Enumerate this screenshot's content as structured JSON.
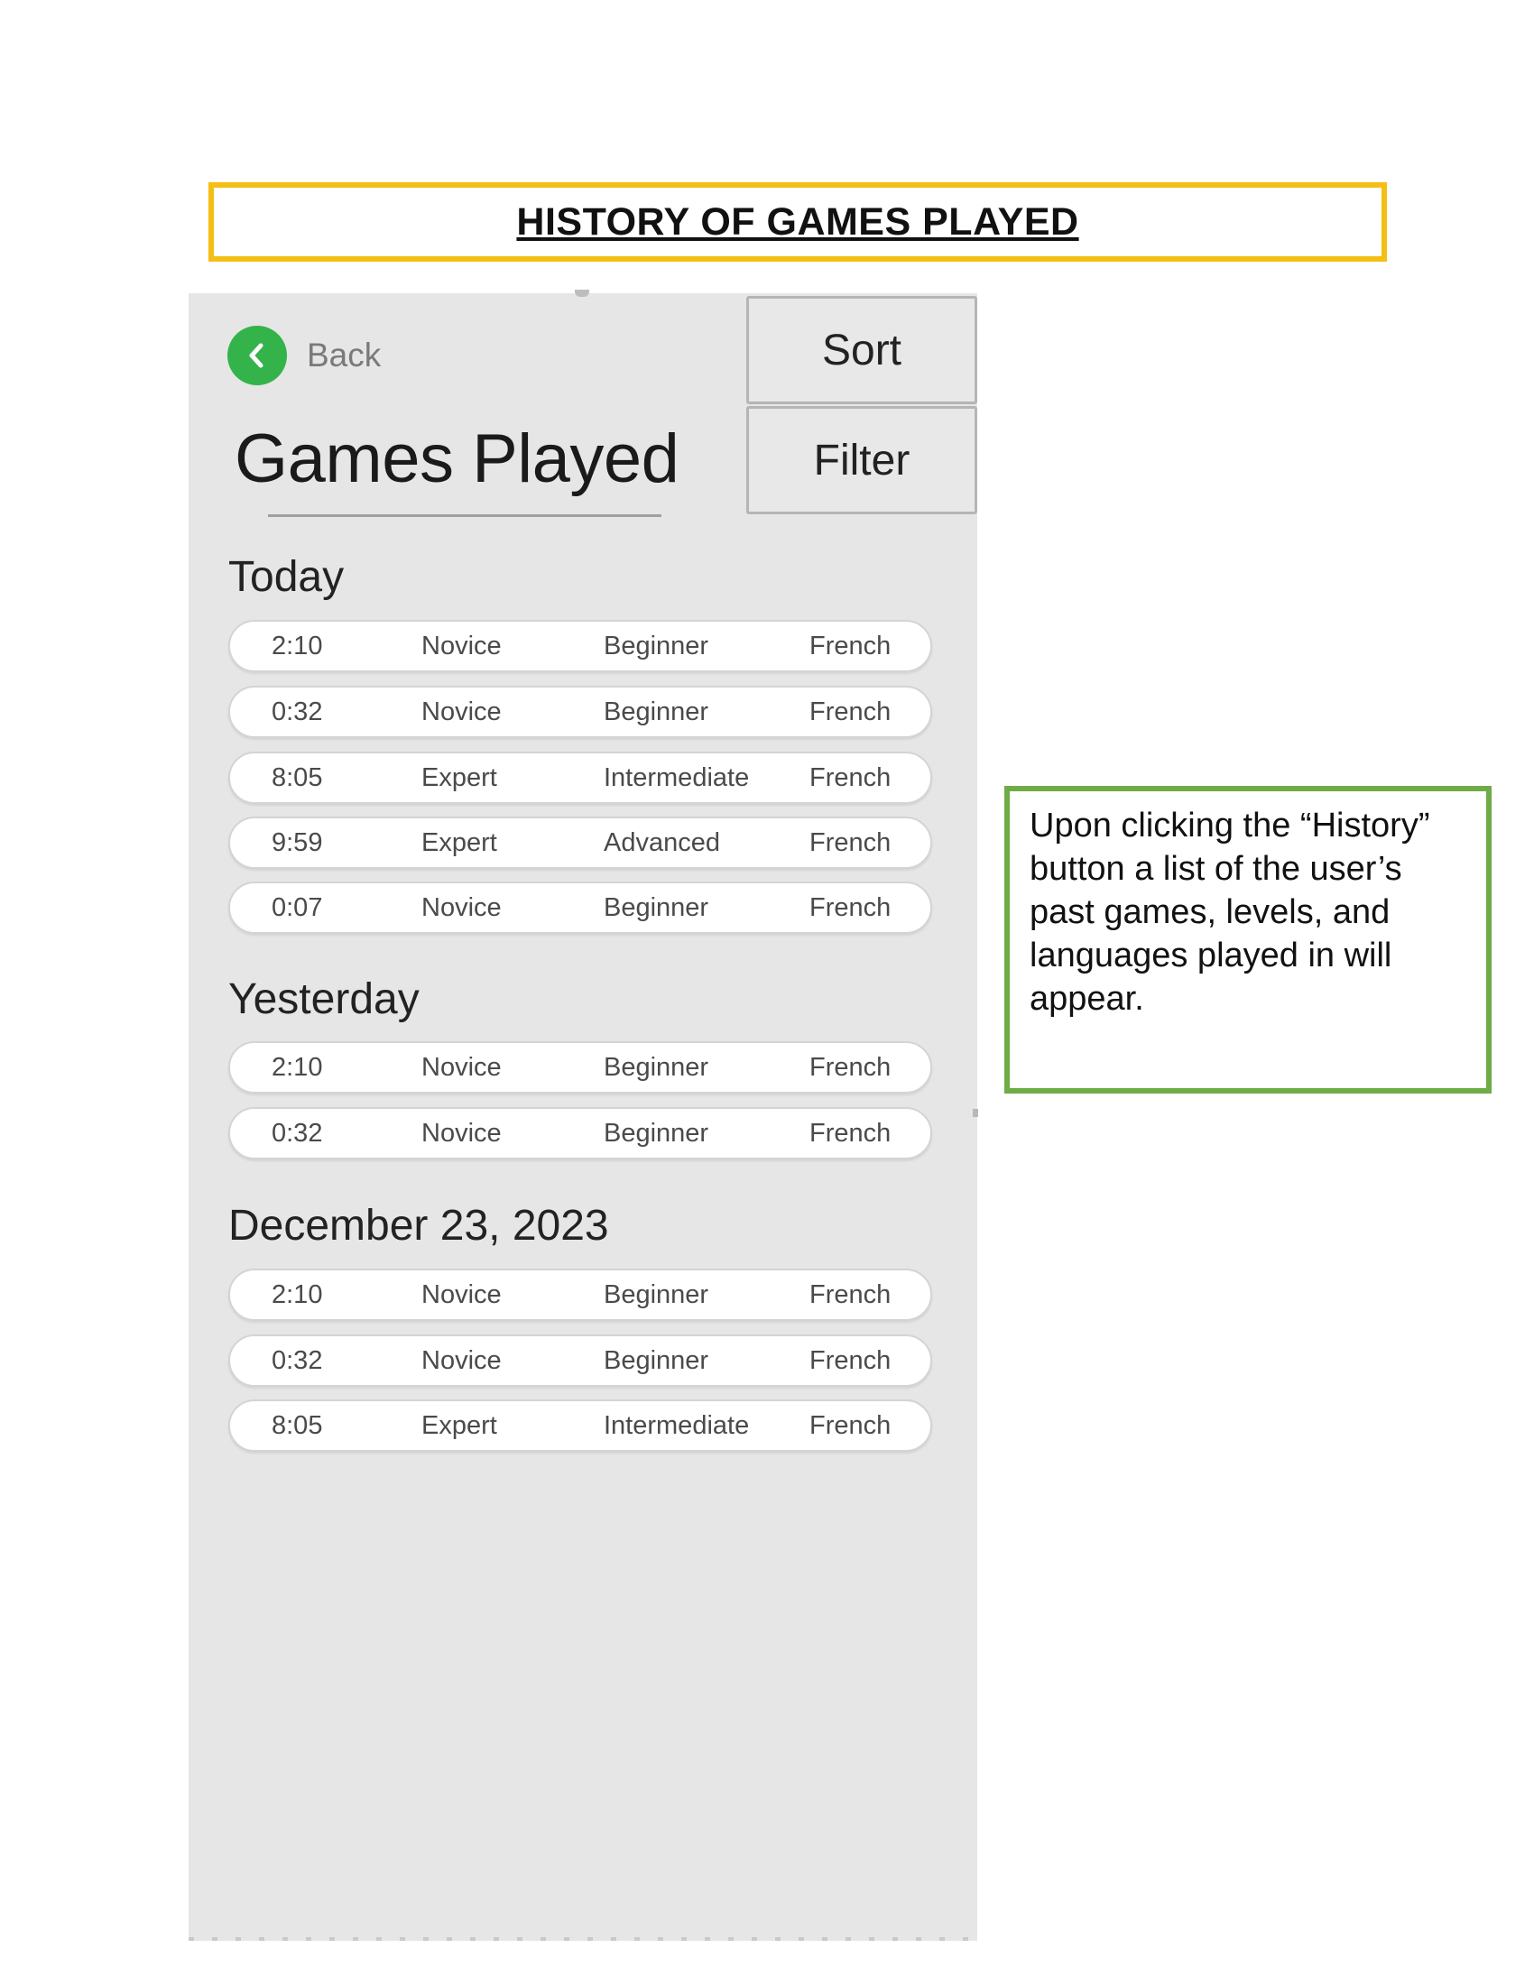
{
  "page_title": "HISTORY OF GAMES PLAYED",
  "header": {
    "back_label": "Back",
    "title": "Games Played",
    "sort_label": "Sort",
    "filter_label": "Filter"
  },
  "sections": [
    {
      "heading": "Today",
      "rows": [
        {
          "time": "2:10",
          "skill": "Novice",
          "level": "Beginner",
          "language": "French"
        },
        {
          "time": "0:32",
          "skill": "Novice",
          "level": "Beginner",
          "language": "French"
        },
        {
          "time": "8:05",
          "skill": "Expert",
          "level": "Intermediate",
          "language": "French"
        },
        {
          "time": "9:59",
          "skill": "Expert",
          "level": "Advanced",
          "language": "French"
        },
        {
          "time": "0:07",
          "skill": "Novice",
          "level": "Beginner",
          "language": "French"
        }
      ]
    },
    {
      "heading": "Yesterday",
      "rows": [
        {
          "time": "2:10",
          "skill": "Novice",
          "level": "Beginner",
          "language": "French"
        },
        {
          "time": "0:32",
          "skill": "Novice",
          "level": "Beginner",
          "language": "French"
        }
      ]
    },
    {
      "heading": "December 23, 2023",
      "rows": [
        {
          "time": "2:10",
          "skill": "Novice",
          "level": "Beginner",
          "language": "French"
        },
        {
          "time": "0:32",
          "skill": "Novice",
          "level": "Beginner",
          "language": "French"
        },
        {
          "time": "8:05",
          "skill": "Expert",
          "level": "Intermediate",
          "language": "French"
        }
      ]
    }
  ],
  "note": "Upon clicking the “History” button a list of the user’s past games, levels, and languages played in will appear.",
  "icons": {
    "back": "chevron-left-icon"
  },
  "colors": {
    "title_border": "#f5be14",
    "note_border": "#6fac46",
    "back_button": "#34b34a",
    "phone_background": "#e6e6e6"
  }
}
